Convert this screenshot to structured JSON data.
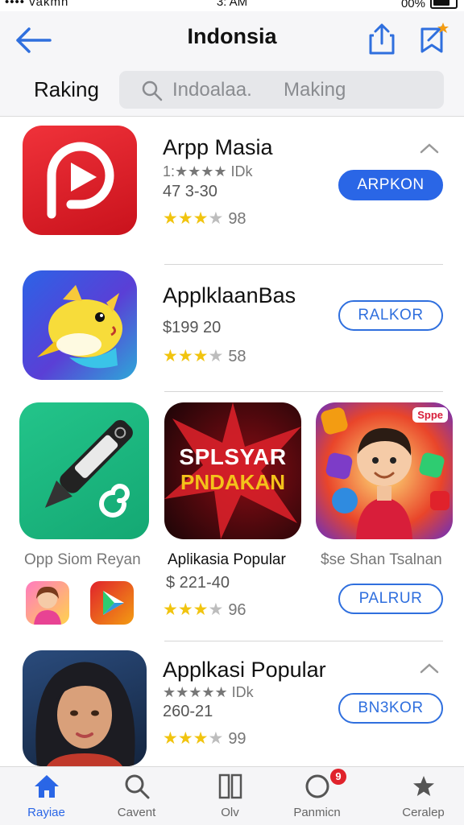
{
  "status_bar": {
    "carrier": "•••• vakmn",
    "time": "3: AM",
    "battery": "00%"
  },
  "header": {
    "title": "Indonsia",
    "segment_label": "Raking",
    "search": {
      "query": "Indoalaa.",
      "scope": "Making"
    }
  },
  "apps": [
    {
      "name": "Arpp Masia",
      "meta": "1:★★★★ IDk",
      "price": "47 3-30",
      "rating": 3,
      "rating_count": "98",
      "button": "ARPKON"
    },
    {
      "name": "ApplklaanBas",
      "price": "$199 20",
      "rating": 3,
      "rating_count": "58",
      "button": "RALKOR"
    },
    {
      "name": "Applkasi Popular",
      "meta": "★★★★★ IDk",
      "price": "260-21",
      "rating": 3,
      "rating_count": "99",
      "button": "BN3KOR"
    }
  ],
  "featured": {
    "captions": [
      "Opp Siom Reyan",
      "Aplikasia Popular",
      "$se Shan Tsalnan"
    ],
    "banner_text": [
      "SPLSYAR",
      "PNDAKAN"
    ],
    "banner_tag": "Sppe",
    "price": "$ 221-40",
    "rating": 3,
    "rating_count": "96",
    "button": "PALRUR"
  },
  "tab_bar": {
    "tabs": [
      {
        "label": "Rayiae",
        "icon": "home-icon"
      },
      {
        "label": "Cavent",
        "icon": "search-icon"
      },
      {
        "label": "Olv",
        "icon": "columns-icon"
      },
      {
        "label": "Panmicn",
        "icon": "circle-icon",
        "badge": "9"
      },
      {
        "label": "Ceralep",
        "icon": "star-icon"
      }
    ]
  },
  "colors": {
    "accent": "#2a66e6",
    "star": "#f1c40f",
    "red_app": "#e0222b"
  }
}
